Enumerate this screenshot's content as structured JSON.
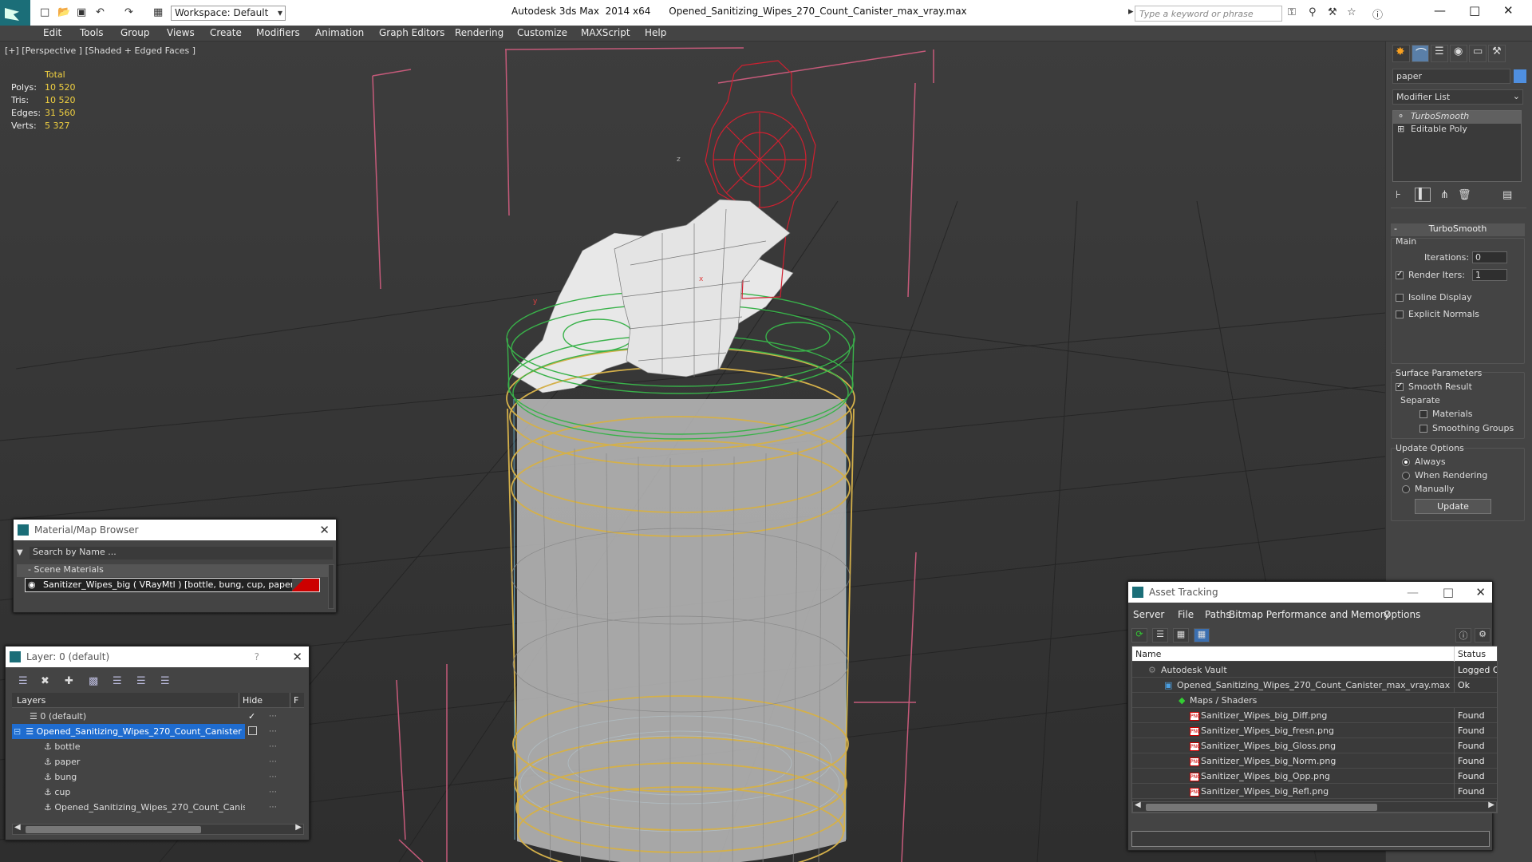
{
  "app": {
    "workspace": "Workspace: Default",
    "window_title": "Autodesk 3ds Max  2014 x64      Opened_Sanitizing_Wipes_270_Count_Canister_max_vray.max",
    "search_placeholder": "Type a keyword or phrase",
    "accent": "#1b6e78"
  },
  "menu": [
    "Edit",
    "Tools",
    "Group",
    "Views",
    "Create",
    "Modifiers",
    "Animation",
    "Graph Editors",
    "Rendering",
    "Customize",
    "MAXScript",
    "Help"
  ],
  "viewport": {
    "label": "[+] [Perspective ] [Shaded + Edged Faces ]",
    "stats": {
      "header": "Total",
      "rows": [
        {
          "label": "Polys:",
          "value": "10 520"
        },
        {
          "label": "Tris:",
          "value": "10 520"
        },
        {
          "label": "Edges:",
          "value": "31 560"
        },
        {
          "label": "Verts:",
          "value": "5 327"
        }
      ]
    },
    "axis_labels": {
      "z": "z",
      "y": "y",
      "x": "x"
    }
  },
  "command_panel": {
    "object_name": "paper",
    "modifier_list": "Modifier List",
    "stack": [
      "TurboSmooth",
      "Editable Poly"
    ],
    "rollout_title": "TurboSmooth",
    "main": "Main",
    "iterations_label": "Iterations:",
    "iterations_value": "0",
    "render_iters_label": "Render Iters:",
    "render_iters_value": "1",
    "isoline": "Isoline Display",
    "explicit_normals": "Explicit Normals",
    "surface_params": "Surface Parameters",
    "smooth_result": "Smooth Result",
    "separate": "Separate",
    "materials": "Materials",
    "smoothing_groups": "Smoothing Groups",
    "update_options": "Update Options",
    "always": "Always",
    "when_rendering": "When Rendering",
    "manually": "Manually",
    "update_button": "Update"
  },
  "material_browser": {
    "title": "Material/Map Browser",
    "search_placeholder": "Search by Name ...",
    "group": "- Scene Materials",
    "item": "Sanitizer_Wipes_big  ( VRayMtl ) [bottle, bung, cup, paper]"
  },
  "layer_panel": {
    "title": "Layer: 0 (default)",
    "help": "?",
    "col_layers": "Layers",
    "col_hide": "Hide",
    "col_f": "F",
    "rows": [
      {
        "name": "0 (default)",
        "indent": 0
      },
      {
        "name": "Opened_Sanitizing_Wipes_270_Count_Canister",
        "indent": 0
      },
      {
        "name": "bottle",
        "indent": 1
      },
      {
        "name": "paper",
        "indent": 1
      },
      {
        "name": "bung",
        "indent": 1
      },
      {
        "name": "cup",
        "indent": 1
      },
      {
        "name": "Opened_Sanitizing_Wipes_270_Count_Canister",
        "indent": 1
      }
    ]
  },
  "asset_tracking": {
    "title": "Asset Tracking",
    "menu": [
      "Server",
      "File",
      "Paths",
      "Bitmap Performance and Memory",
      "Options"
    ],
    "col_name": "Name",
    "col_status": "Status",
    "rows": [
      {
        "name": "Autodesk Vault",
        "status": "Logged O"
      },
      {
        "name": "Opened_Sanitizing_Wipes_270_Count_Canister_max_vray.max",
        "status": "Ok"
      },
      {
        "name": "Maps / Shaders",
        "status": ""
      },
      {
        "name": "Sanitizer_Wipes_big_Diff.png",
        "status": "Found"
      },
      {
        "name": "Sanitizer_Wipes_big_fresn.png",
        "status": "Found"
      },
      {
        "name": "Sanitizer_Wipes_big_Gloss.png",
        "status": "Found"
      },
      {
        "name": "Sanitizer_Wipes_big_Norm.png",
        "status": "Found"
      },
      {
        "name": "Sanitizer_Wipes_big_Opp.png",
        "status": "Found"
      },
      {
        "name": "Sanitizer_Wipes_big_Refl.png",
        "status": "Found"
      }
    ]
  }
}
